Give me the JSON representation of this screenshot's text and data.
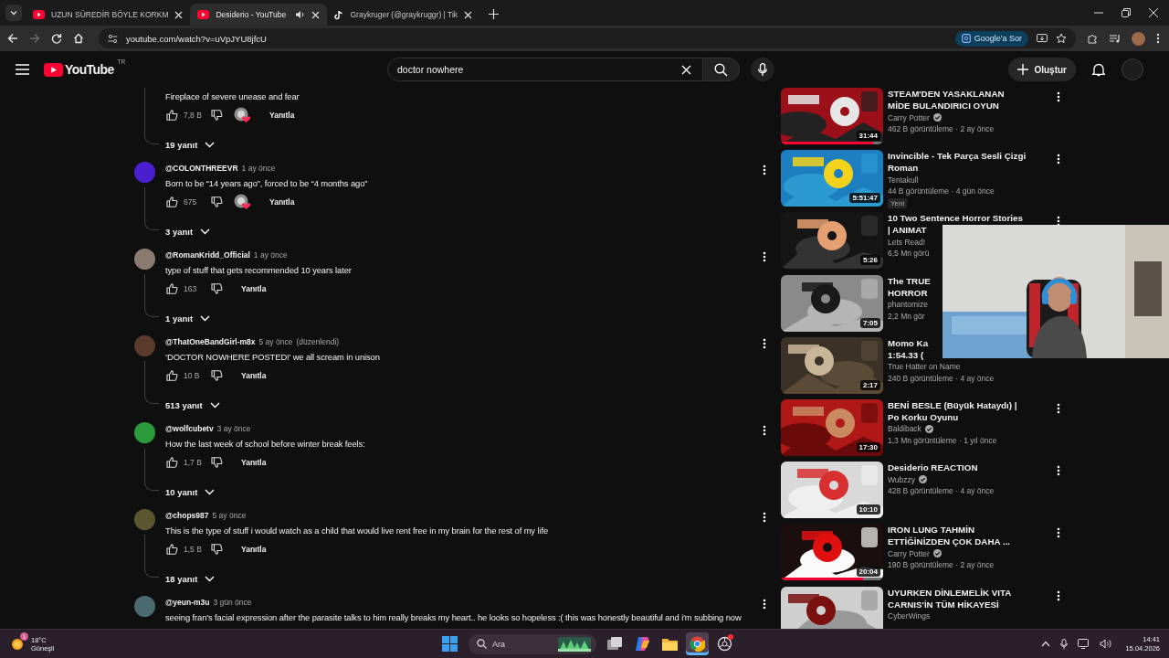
{
  "browser": {
    "tabs": [
      {
        "title": "UZUN SÜREDİR BÖYLE KORKM",
        "kind": "youtube",
        "audio": false,
        "selected": false
      },
      {
        "title": "Desiderio - YouTube",
        "kind": "youtube",
        "audio": true,
        "selected": true
      },
      {
        "title": "Graykruger (@graykruggr) | Tik",
        "kind": "tiktok",
        "audio": false,
        "selected": false
      }
    ],
    "nav": [
      {
        "kind": "back",
        "disabled": false
      },
      {
        "kind": "forward",
        "disabled": true
      },
      {
        "kind": "reload",
        "disabled": false
      },
      {
        "kind": "home",
        "disabled": false
      }
    ],
    "url": "youtube.com/watch?v=uVpJYU8jfcU",
    "ask_button": "Google'a Sor"
  },
  "header": {
    "logo": "YouTube",
    "region": "TR",
    "search": {
      "value": "doctor nowhere"
    },
    "create_button": "Oluştur"
  },
  "comments": [
    {
      "text": "Fireplace of severe unease and fear",
      "likes": "7,8 B",
      "hearted": true,
      "reply_button": "Yanıtla",
      "replies": "19 yanıt"
    },
    {
      "author": "@COLONTHREEVR",
      "time": "1 ay önce",
      "color": "#4a1fd0",
      "text": "Born to be “14 years ago”, forced to be “4 months ago”",
      "likes": "675",
      "hearted": true,
      "reply_button": "Yanıtla",
      "replies": "3 yanıt"
    },
    {
      "author": "@RomanKridd_Official",
      "time": "1 ay önce",
      "color": "#8a7a70",
      "text": "type of stuff that gets recommended 10 years later",
      "likes": "163",
      "hearted": false,
      "reply_button": "Yanıtla",
      "replies": "1 yanıt"
    },
    {
      "author": "@ThatOneBandGirl-m8x",
      "time": "5 ay önce",
      "edited": "(düzenlendi)",
      "color": "#5a3a2a",
      "text": "‘DOCTOR NOWHERE POSTED!’ we all scream in unison",
      "likes": "10 B",
      "hearted": false,
      "reply_button": "Yanıtla",
      "replies": "513 yanıt"
    },
    {
      "author": "@wolfcubetv",
      "time": "3 ay önce",
      "color": "#2a9a3a",
      "text": "How the last week of school before winter break feels:",
      "likes": "1,7 B",
      "hearted": false,
      "reply_button": "Yanıtla",
      "replies": "10 yanıt"
    },
    {
      "author": "@chops987",
      "time": "5 ay önce",
      "color": "#5a5630",
      "text": "This is the type of stuff i would watch as a child that would live rent free in my brain for the rest of my life",
      "likes": "1,5 B",
      "hearted": false,
      "reply_button": "Yanıtla",
      "replies": "18 yanıt"
    },
    {
      "author": "@yeun-m3u",
      "time": "3 gün önce",
      "color": "#4a6a70",
      "text": "seeing fran's facial expression after the parasite talks to him really breaks my heart.. he looks so hopeless :( this was honestly beautiful and i'm subbing now"
    }
  ],
  "videos": [
    {
      "title_lines": [
        "STEAM'DEN YASAKLANAN",
        "MİDE BULANDIRICI OYUN"
      ],
      "channel": "Carry Potter",
      "verified": true,
      "meta": "462 B görüntüleme · 2 ay önce",
      "duration": "31:44",
      "level": 0.9,
      "menu": true
    },
    {
      "title_lines": [
        "Invincible - Tek Parça Sesli Çizgi",
        "Roman"
      ],
      "channel": "Tentakull",
      "verified": false,
      "meta": "44 B görüntüleme · 4 gün önce",
      "badge": "Yeni",
      "duration": "5:51:47",
      "menu": true
    },
    {
      "title_lines": [
        "10 Two Sentence Horror Stories",
        "| ANIMAT"
      ],
      "channel": "Lets Read!",
      "verified": false,
      "meta": "6,5 Mn görü",
      "duration": "5:26",
      "menu": true
    },
    {
      "title_lines": [
        "The TRUE",
        "HORROR"
      ],
      "channel": "phantomize",
      "verified": false,
      "meta": "2,2 Mn gör",
      "duration": "7:05",
      "menu": false
    },
    {
      "title_lines": [
        "Momo Ka",
        "1:54.33 ("
      ],
      "channel": "True Hatter on Name",
      "verified": false,
      "meta": "240 B görüntüleme · 4 ay önce",
      "duration": "2:17",
      "menu": false
    },
    {
      "title_lines": [
        "BENİ  BESLE (Büyük Hataydı) |",
        "Po Korku Oyunu"
      ],
      "channel": "Baldiback",
      "verified": true,
      "meta": "1,3 Mn görüntüleme · 1 yıl önce",
      "duration": "17:30",
      "menu": true
    },
    {
      "title_lines": [
        "Desiderio REACTION"
      ],
      "channel": "Wubzzy",
      "verified": true,
      "meta": "428 B görüntüleme · 4 ay önce",
      "duration": "10:10",
      "menu": true
    },
    {
      "title_lines": [
        "IRON LUNG TAHMİN",
        "ETTİĞİNİZDEN ÇOK DAHA ..."
      ],
      "channel": "Carry Potter",
      "verified": true,
      "meta": "190 B görüntüleme · 2 ay önce",
      "duration": "20:04",
      "level": 0.8,
      "menu": true
    },
    {
      "title_lines": [
        "UYURKEN DİNLEMELİK VITA",
        "CARNIS'İN TÜM HİKAYESİ"
      ],
      "channel": "CyberWings",
      "verified": false,
      "menu": true
    }
  ],
  "taskbar": {
    "weather": {
      "temperature": "18°C",
      "condition": "Güneşli",
      "badge": "1"
    },
    "items": [
      {
        "kind": "start",
        "active": false,
        "notification": false
      },
      {
        "kind": "search",
        "placeholder": "Ara",
        "active": false
      },
      {
        "kind": "taskview",
        "active": false,
        "notification": false
      },
      {
        "kind": "copilot",
        "active": false,
        "notification": false
      },
      {
        "kind": "explorer",
        "active": false,
        "notification": false
      },
      {
        "kind": "chrome",
        "active": true,
        "notification": false
      },
      {
        "kind": "recorder",
        "active": false,
        "notification": true
      }
    ],
    "time": "14:41",
    "date": "15.04.2026"
  }
}
